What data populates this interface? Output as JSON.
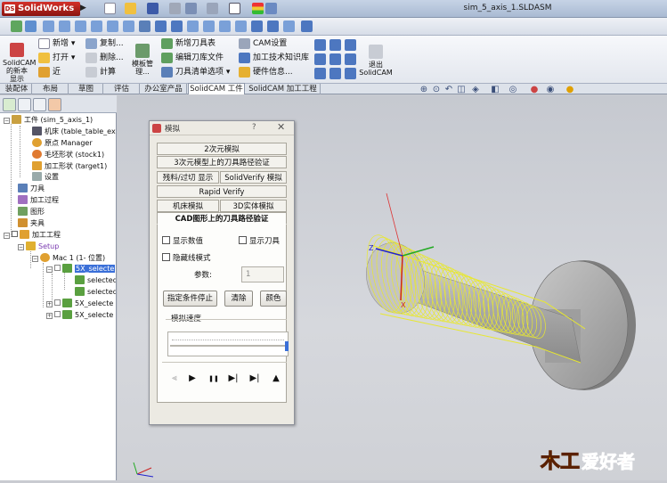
{
  "app": {
    "logo_text": "SolidWorks",
    "logo_badge": "DS",
    "document_title": "sim_5_axis_1.SLDASM"
  },
  "ribbon": {
    "solidcam_new": "SolidCAM\n的新本\n显示",
    "new": "新增",
    "open": "打开",
    "recent": "近",
    "copy": "复制...",
    "delete": "删除...",
    "calc": "計算",
    "template_mgr": "模板管\n理...",
    "new_tool_table": "新增刀具表",
    "edit_tool_lib": "编辑刀库文件",
    "tool_list_options": "刀具清单选项",
    "cam_settings": "CAM设置",
    "tech_db": "加工技术知识库",
    "hardware_info": "硬件信息...",
    "exit_solidcam": "退出\nSolidCAM"
  },
  "tabs": [
    {
      "label": "装配体",
      "active": false
    },
    {
      "label": "布局",
      "active": false
    },
    {
      "label": "草图",
      "active": false
    },
    {
      "label": "评估",
      "active": false
    },
    {
      "label": "办公室产品",
      "active": false
    },
    {
      "label": "SolidCAM 工件",
      "active": true
    },
    {
      "label": "SolidCAM 加工工程",
      "active": false
    }
  ],
  "tree": {
    "part": "工件 (sim_5_axis_1)",
    "machine": "机床 (table_table_exer",
    "origin": "原点 Manager",
    "stock": "毛坯形状 (stock1)",
    "target": "加工形状 (target1)",
    "settings": "设置",
    "tools": "刀具",
    "process": "加工过程",
    "geometry": "图形",
    "fixture": "夹具",
    "machining": "加工工程",
    "setup": "Setup",
    "mac": "Mac 1 (1- 位置)",
    "op1": "5X_selecte",
    "op1_child1": "selected_",
    "op1_child2": "selected_",
    "op2": "5X_selecte",
    "op3": "5X_selecte"
  },
  "dialog": {
    "title": "模拟",
    "help": "?",
    "close": "✕",
    "tab_2d": "2次元模拟",
    "tab_3d_verify": "3次元模型上的刀具路径验证",
    "tab_rest": "残料/过切 显示",
    "tab_solidverify": "SolidVerify 模拟",
    "tab_rapid": "Rapid Verify",
    "tab_machine": "机床模拟",
    "tab_3dsolid": "3D实体模拟",
    "tab_cad": "CAD图形上的刀具路径验证",
    "show_values": "显示数值",
    "show_tool": "显示刀具",
    "hidden_mode": "隐藏线模式",
    "param_label": "参数:",
    "param_value": "1",
    "btn_stop_cond": "指定条件停止",
    "btn_clear": "清除",
    "btn_color": "颜色",
    "speed_label": "模拟速度"
  },
  "colors": {
    "toolpath": "#e8e830",
    "accent": "#3a6fd8",
    "part_gray": "#b8b8b8"
  },
  "watermark": {
    "text": "爱好者",
    "prefix": "木工"
  }
}
